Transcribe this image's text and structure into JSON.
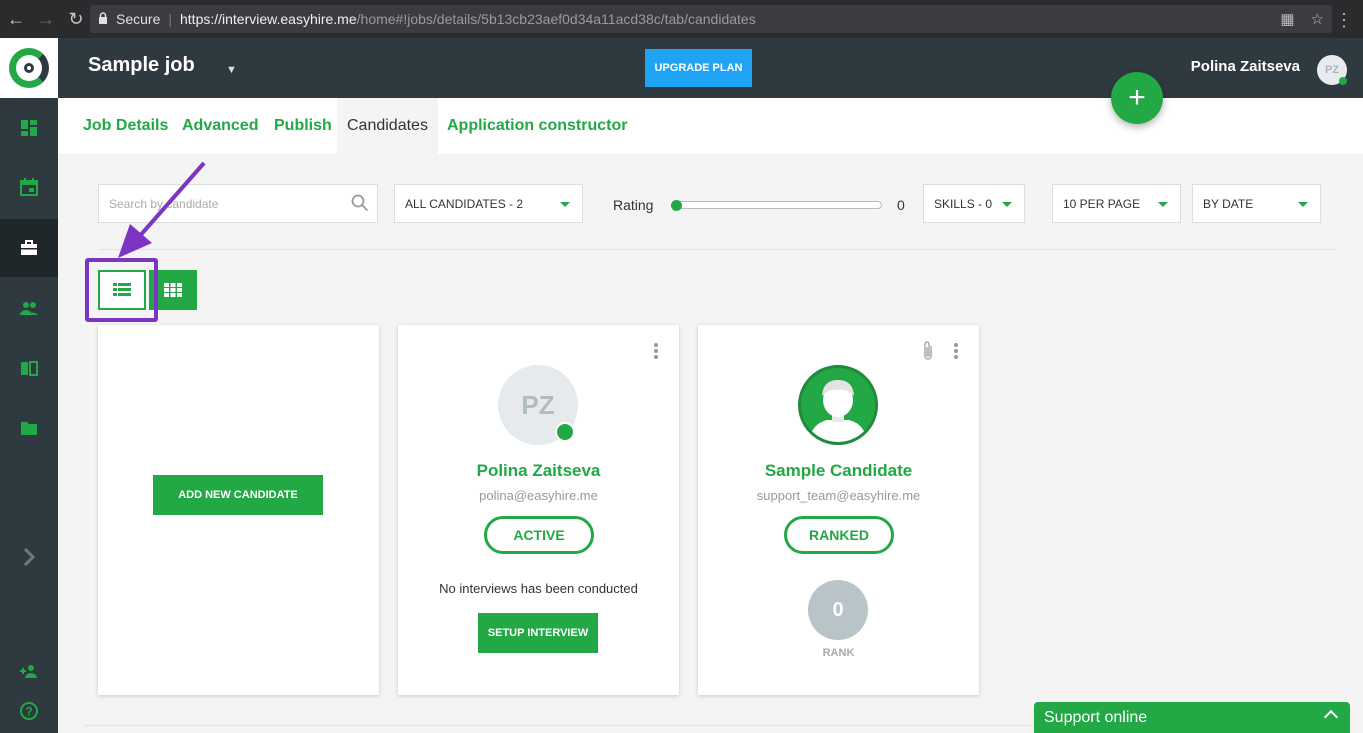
{
  "browser": {
    "secure_label": "Secure",
    "url_host": "https://interview.easyhire.me",
    "url_path": "/home#!jobs/details/5b13cb23aef0d34a11acd38c/tab/candidates"
  },
  "header": {
    "job_title": "Sample job",
    "upgrade_label": "UPGRADE PLAN",
    "user_name": "Polina Zaitseva",
    "user_initials": "PZ"
  },
  "tabs": [
    {
      "label": "Job Details"
    },
    {
      "label": "Advanced"
    },
    {
      "label": "Publish"
    },
    {
      "label": "Candidates"
    },
    {
      "label": "Application constructor"
    }
  ],
  "filters": {
    "search_placeholder": "Search by candidate",
    "candidates_filter": "ALL CANDIDATES - 2",
    "rating_label": "Rating",
    "rating_value": "0",
    "skills_filter": "SKILLS - 0",
    "per_page": "10 PER PAGE",
    "sort": "BY DATE"
  },
  "add_card": {
    "button_label": "ADD NEW CANDIDATE"
  },
  "candidates": [
    {
      "initials": "PZ",
      "name": "Polina Zaitseva",
      "email": "polina@easyhire.me",
      "status": "ACTIVE",
      "note": "No interviews has been conducted",
      "action_label": "SETUP INTERVIEW"
    },
    {
      "name": "Sample Candidate",
      "email": "support_team@easyhire.me",
      "status": "RANKED",
      "rank": "0",
      "rank_label": "RANK"
    }
  ],
  "support": {
    "label": "Support online"
  },
  "colors": {
    "accent": "#22a845",
    "sidebar": "#2f3a40",
    "upgrade": "#1fa3f5",
    "highlight": "#7b35c2"
  }
}
